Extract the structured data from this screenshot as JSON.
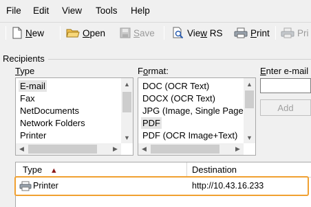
{
  "menu": {
    "file": "File",
    "edit": "Edit",
    "view": "View",
    "tools": "Tools",
    "help": "Help"
  },
  "toolbar": {
    "new_accel": "N",
    "new_rest": "ew",
    "open_accel": "O",
    "open_rest": "pen",
    "save_accel": "S",
    "save_rest": "ave",
    "view_rs_pre": "Vie",
    "view_rs_accel": "w",
    "view_rs_post": " RS",
    "print_accel": "P",
    "print_rest": "rint",
    "print_rs_label": "Pri"
  },
  "recipients": {
    "group_label": "Recipients",
    "type_label_accel": "T",
    "type_label_rest": "ype",
    "format_label_pre": "F",
    "format_label_accel": "o",
    "format_label_post": "rmat:",
    "email_label_accel": "E",
    "email_label_rest": "nter e-mail a",
    "add_button": "Add"
  },
  "type_list": [
    {
      "label": "E-mail",
      "selected": true
    },
    {
      "label": "Fax",
      "selected": false
    },
    {
      "label": "NetDocuments",
      "selected": false
    },
    {
      "label": "Network Folders",
      "selected": false
    },
    {
      "label": "Printer",
      "selected": false
    }
  ],
  "format_list": [
    {
      "label": "DOC (OCR Text)",
      "selected": false
    },
    {
      "label": "DOCX (OCR Text)",
      "selected": false
    },
    {
      "label": "JPG (Image, Single Page",
      "selected": false
    },
    {
      "label": "PDF",
      "selected": true
    },
    {
      "label": "PDF (OCR Image+Text)",
      "selected": false
    }
  ],
  "table": {
    "col_type": "Type",
    "col_destination": "Destination",
    "sort_arrow": "▲",
    "rows": [
      {
        "type": "Printer",
        "destination": "http://10.43.16.233"
      }
    ]
  },
  "colors": {
    "highlight_border": "#f0a030",
    "sort_arrow": "#8b1a1a",
    "selection_bg": "#e5e5e5"
  },
  "icons": {
    "new": "new-document-icon",
    "open": "open-folder-icon",
    "save": "save-disk-icon",
    "view_rs": "view-magnifier-icon",
    "print": "printer-icon",
    "print_rs": "printer-rs-icon",
    "row": "printer-icon"
  }
}
